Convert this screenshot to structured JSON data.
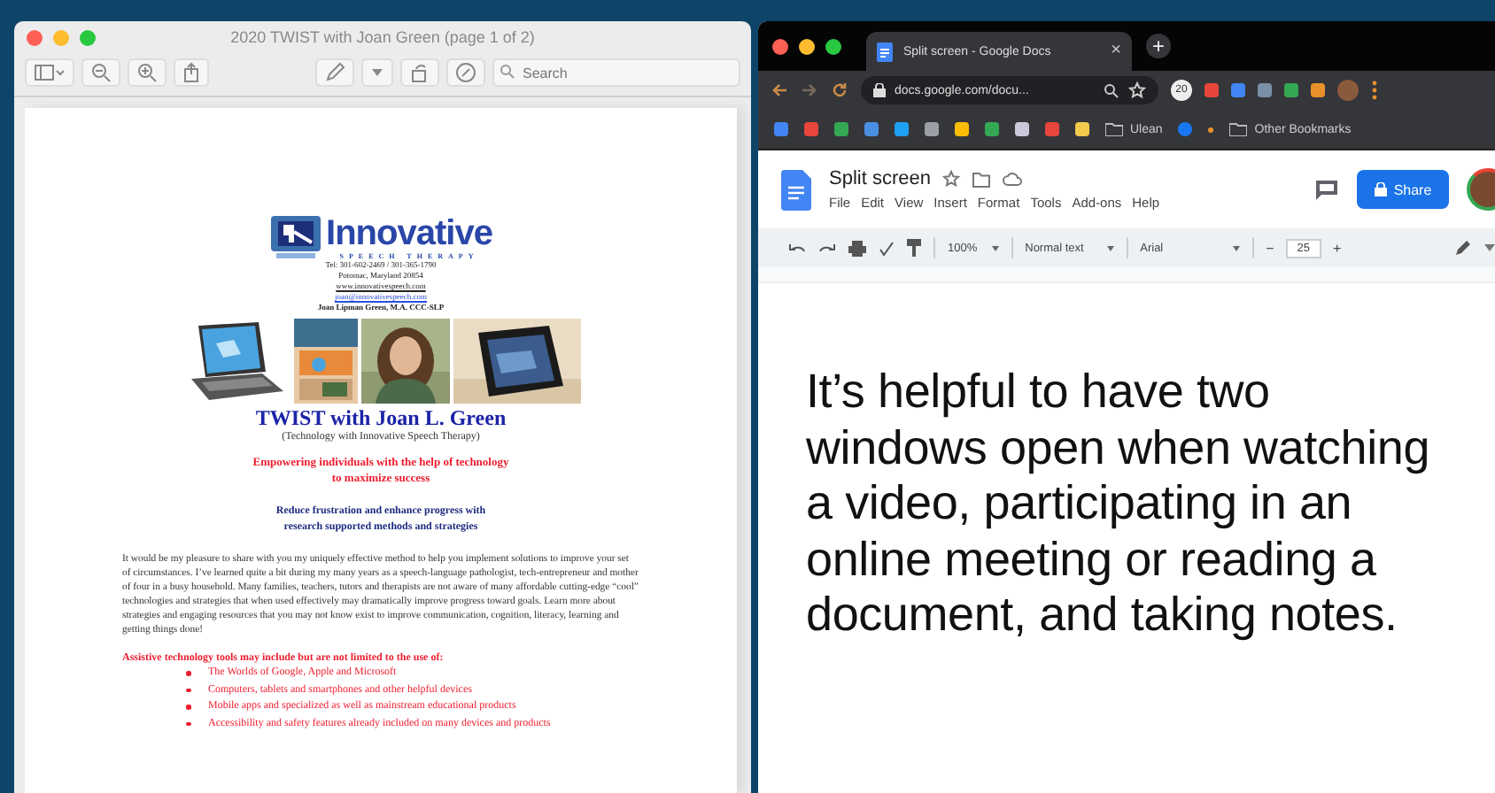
{
  "preview": {
    "title": "2020 TWIST with Joan Green (page 1 of 2)",
    "search": {
      "placeholder": "Search"
    },
    "document": {
      "logo_name": "Innovative",
      "logo_tagline": "SPEECH THERAPY",
      "contact_lines": [
        "Tel: 301-602-2469 / 301-365-1790",
        "Potomac, Maryland 20854"
      ],
      "links": [
        "www.innovativespeech.com",
        "joan@innovativespeech.com"
      ],
      "author": "Joan Lipman Green, M.A. CCC-SLP",
      "heading": "TWIST with Joan L. Green",
      "subheading": "(Technology with Innovative Speech Therapy)",
      "tagline_lines": [
        "Empowering individuals with the help of technology",
        "to maximize success"
      ],
      "goal_lines": [
        "Reduce frustration and enhance progress with",
        "research supported methods and strategies"
      ],
      "paragraph": "It would be my pleasure to share with you my uniquely effective method to help you implement solutions to improve your set of circumstances. I’ve learned quite a bit during my many years as a speech-language pathologist, tech-entrepreneur and mother of four in a busy household. Many families, teachers, tutors and therapists are not aware of many affordable cutting-edge “cool” technologies and strategies that when used effectively may dramatically improve progress toward goals. Learn more about strategies and engaging resources that you may not know exist to improve communication, cognition, literacy, learning and getting things done!",
      "list_intro": "Assistive technology tools may include but are not limited to the use of:",
      "bullets": [
        "The Worlds of Google, Apple and Microsoft",
        "Computers, tablets and smartphones and other helpful devices",
        "Mobile apps and specialized as well as mainstream educational products",
        "Accessibility and safety features already included on many devices and products"
      ]
    }
  },
  "browser": {
    "tab": {
      "title": "Split screen - Google Docs",
      "close": "×"
    },
    "new_tab": "+",
    "url": "docs.google.com/docu...",
    "extension_badge": "20",
    "bookmarks": [
      {
        "label": "Ulean"
      },
      {
        "label": "Other Bookmarks"
      }
    ],
    "docs": {
      "title": "Split screen",
      "menu": [
        "File",
        "Edit",
        "View",
        "Insert",
        "Format",
        "Tools",
        "Add-ons",
        "Help"
      ],
      "share": "Share",
      "toolbar": {
        "zoom": "100%",
        "style": "Normal text",
        "font": "Arial",
        "minus": "−",
        "size": "25",
        "plus": "+"
      },
      "body_lines": [
        "It’s helpful to have two",
        "windows open when watching",
        "a video, participating in an",
        "online meeting or reading a",
        "document, and taking notes."
      ]
    }
  }
}
